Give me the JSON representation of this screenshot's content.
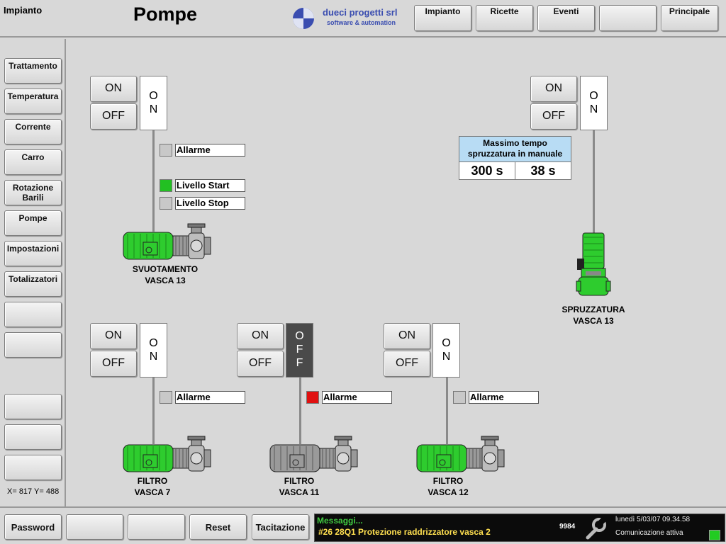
{
  "header": {
    "area": "Impianto",
    "title": "Pompe",
    "logo_name": "dueci progetti srl",
    "logo_sub": "software & automation",
    "nav": [
      "Impianto",
      "Ricette",
      "Eventi",
      "",
      "Principale"
    ]
  },
  "sidebar": {
    "items": [
      "Trattamento",
      "Temperatura",
      "Corrente",
      "Carro",
      "Rotazione\nBarili",
      "Pompe",
      "Impostazioni",
      "Totalizzatori",
      "",
      "",
      "",
      "",
      ""
    ],
    "coords": "X= 817 Y= 488"
  },
  "pumps": [
    {
      "id": "svuotamento",
      "on_label": "ON",
      "off_label": "OFF",
      "state": "ON",
      "name_line1": "SVUOTAMENTO",
      "name_line2": "VASCA 13",
      "alarm_label": "Allarme",
      "alarm": "gray",
      "level_start": "Livello Start",
      "level_start_state": "green",
      "level_stop": "Livello Stop",
      "level_stop_state": "gray",
      "motor_color": "green"
    },
    {
      "id": "spruzzatura",
      "on_label": "ON",
      "off_label": "OFF",
      "state": "ON",
      "name_line1": "SPRUZZATURA",
      "name_line2": "VASCA 13",
      "motor_color": "green"
    },
    {
      "id": "filtro7",
      "on_label": "ON",
      "off_label": "OFF",
      "state": "ON",
      "name_line1": "FILTRO",
      "name_line2": "VASCA 7",
      "alarm_label": "Allarme",
      "alarm": "gray",
      "motor_color": "green"
    },
    {
      "id": "filtro11",
      "on_label": "ON",
      "off_label": "OFF",
      "state": "OFF",
      "name_line1": "FILTRO",
      "name_line2": "VASCA 11",
      "alarm_label": "Allarme",
      "alarm": "red",
      "motor_color": "gray"
    },
    {
      "id": "filtro12",
      "on_label": "ON",
      "off_label": "OFF",
      "state": "ON",
      "name_line1": "FILTRO",
      "name_line2": "VASCA 12",
      "alarm_label": "Allarme",
      "alarm": "gray",
      "motor_color": "green"
    }
  ],
  "max_time": {
    "title_line1": "Massimo tempo",
    "title_line2": "spruzzatura in manuale",
    "setpoint": "300 s",
    "actual": "38 s"
  },
  "footer": {
    "buttons": [
      "Password",
      "",
      "",
      "Reset",
      "Tacitazione"
    ],
    "msg_title": "Messaggi...",
    "msg_text": "#26 28Q1 Protezione raddrizzatore vasca 2",
    "msg_count": "9984",
    "datetime": "lunedì 5/03/07 09.34.58",
    "status": "Comunicazione attiva"
  },
  "colors": {
    "motor_green": "#2ecc2e",
    "motor_gray": "#9a9a9a",
    "alarm_red": "#e01010",
    "panel_bg": "#d8d8d8",
    "msg_green": "#40c840",
    "msg_yellow": "#ffe050",
    "logo_blue": "#3a4db0"
  }
}
